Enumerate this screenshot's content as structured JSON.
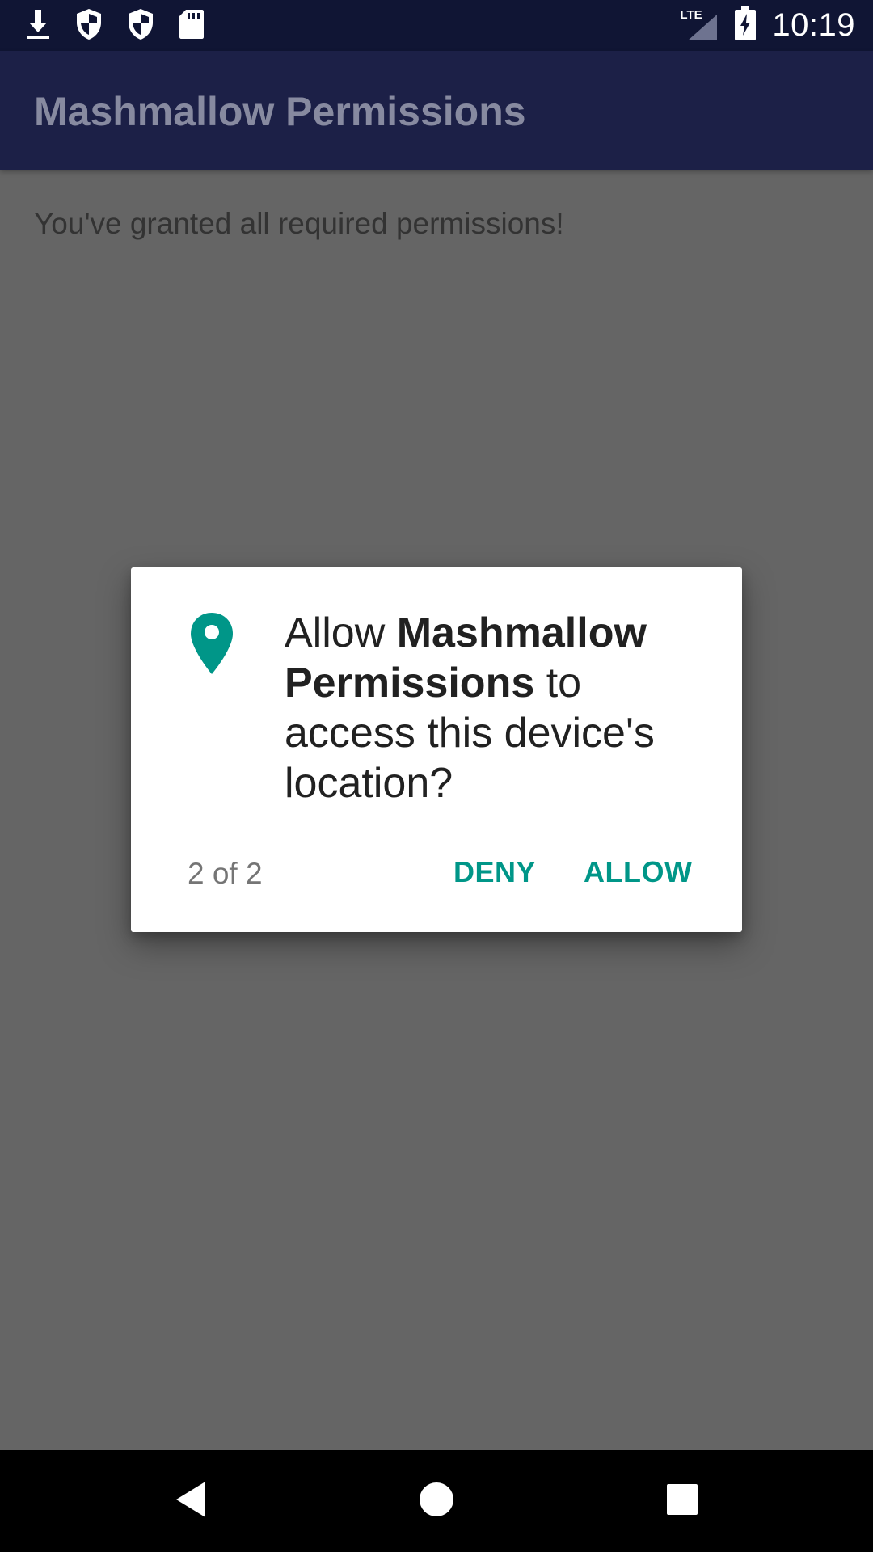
{
  "status_bar": {
    "time": "10:19",
    "network_label": "LTE",
    "icons": [
      "download-icon",
      "shield-icon",
      "shield-icon",
      "sd-card-icon",
      "signal-icon",
      "battery-charging-icon"
    ]
  },
  "app_bar": {
    "title": "Mashmallow Permissions"
  },
  "content": {
    "message": "You've granted all required permissions!"
  },
  "dialog": {
    "icon": "location-pin-icon",
    "message_prefix": "Allow ",
    "app_name": "Mashmallow Permissions",
    "message_suffix": " to access this device's location?",
    "counter": "2 of 2",
    "deny_label": "DENY",
    "allow_label": "ALLOW"
  },
  "nav_bar": {
    "icons": [
      "back-icon",
      "home-icon",
      "recents-icon"
    ]
  },
  "colors": {
    "status_bar": "#101534",
    "app_bar": "#1c2047",
    "scrim_background": "#656565",
    "accent": "#009688",
    "dialog_background": "#ffffff"
  }
}
